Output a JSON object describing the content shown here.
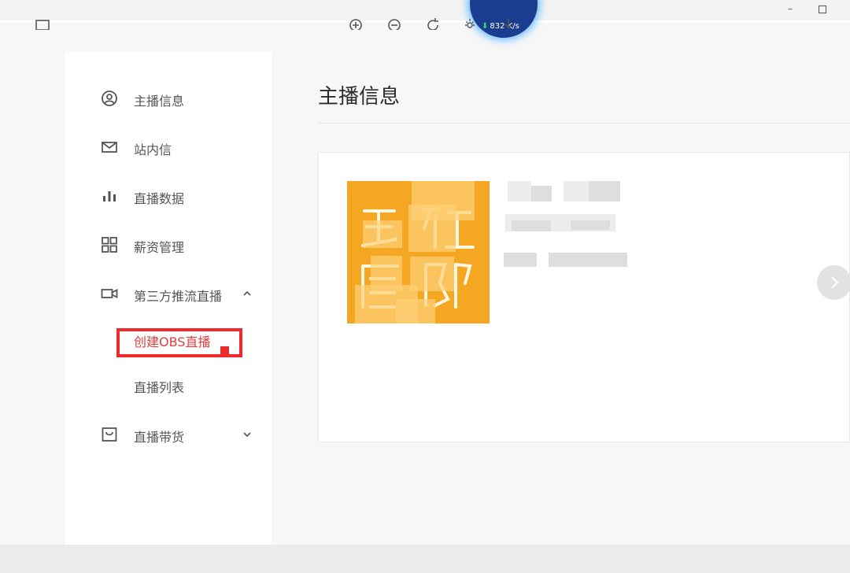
{
  "window": {
    "minimize_glyph": "–",
    "maximize_icon": "maximize-icon",
    "network_speed": "832 K/s"
  },
  "sidebar": {
    "items": [
      {
        "label": "主播信息",
        "icon": "user-circle-icon"
      },
      {
        "label": "站内信",
        "icon": "mail-icon"
      },
      {
        "label": "直播数据",
        "icon": "bar-chart-icon"
      },
      {
        "label": "薪资管理",
        "icon": "grid-icon"
      },
      {
        "label": "第三方推流直播",
        "icon": "video-camera-icon",
        "expanded": true,
        "children": [
          {
            "label": "创建OBS直播",
            "active": true
          },
          {
            "label": "直播列表",
            "active": false
          }
        ]
      },
      {
        "label": "直播带货",
        "icon": "shopping-bag-icon",
        "expanded": false
      }
    ]
  },
  "main": {
    "title": "主播信息"
  },
  "colors": {
    "accent_red": "#e04040",
    "highlight_border": "#ee2a2a",
    "avatar_bg": "#f5a623"
  },
  "bottom_toolbar": {
    "icons": [
      "square-icon",
      "zoom-in-icon",
      "zoom-out-icon",
      "rotate-icon",
      "brightness-icon",
      "download-icon"
    ]
  }
}
